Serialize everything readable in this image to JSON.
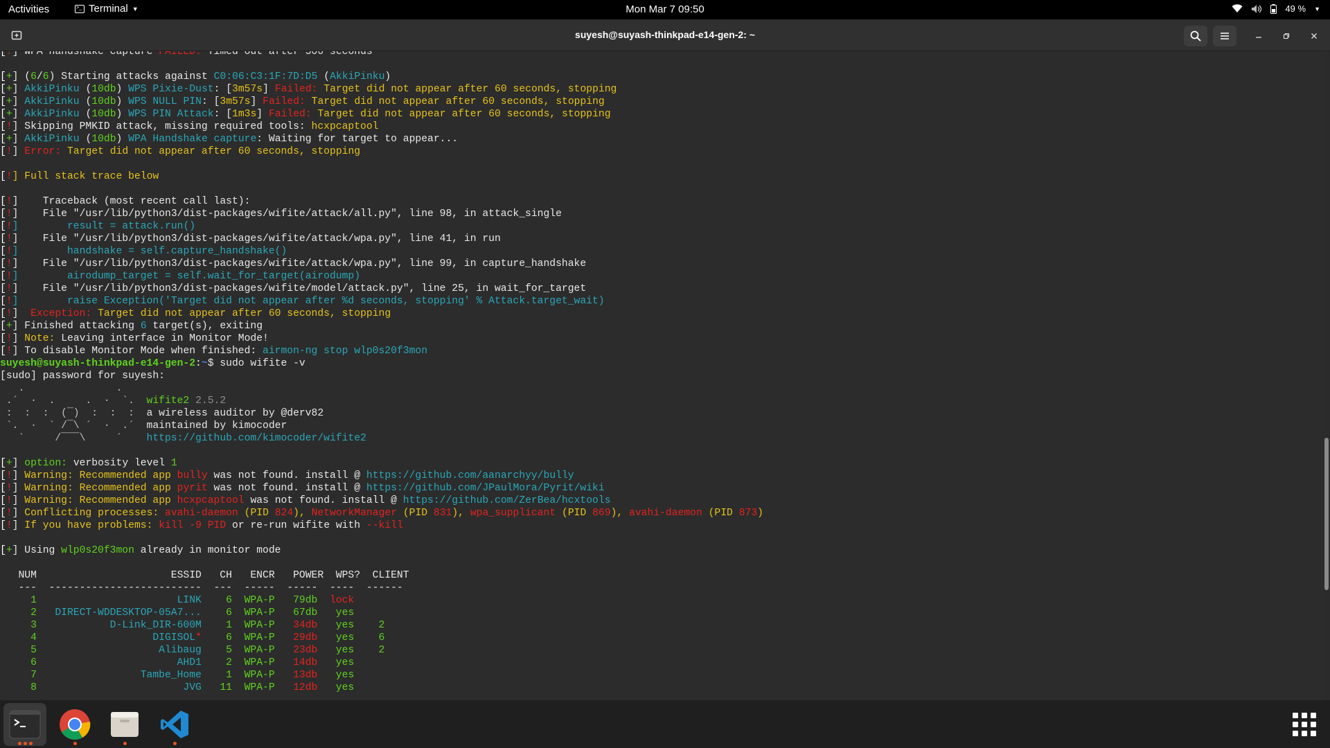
{
  "topbar": {
    "activities": "Activities",
    "app_name": "Terminal",
    "clock": "Mon Mar 7  09:50",
    "battery": "49 %"
  },
  "window": {
    "title": "suyesh@suyash-thinkpad-e14-gen-2: ~"
  },
  "icons": {
    "new_tab": "new-tab-icon",
    "search": "search-icon",
    "menu": "hamburger-menu-icon",
    "minimize": "minimize-icon",
    "maximize": "maximize-icon",
    "close": "close-icon",
    "wifi": "wifi-icon",
    "volume": "volume-icon",
    "battery": "battery-icon"
  },
  "colors": {
    "red": "#e3231f",
    "green": "#5fd21e",
    "cyan": "#2aa7b8",
    "yellow": "#e6c21b",
    "prompt_blue": "#4b7fd8",
    "accent": "#e95420"
  },
  "terminal": {
    "lines": [
      [
        {
          "t": "[",
          "c": "w"
        },
        {
          "t": "!",
          "c": "r"
        },
        {
          "t": "] WPA handshake capture "
        },
        {
          "t": "FAILED:",
          "c": "r"
        },
        {
          "t": " Timed out after 500 seconds"
        }
      ],
      [],
      [
        {
          "t": "[",
          "c": "w"
        },
        {
          "t": "+",
          "c": "g"
        },
        {
          "t": "] ("
        },
        {
          "t": "6",
          "c": "g"
        },
        {
          "t": "/"
        },
        {
          "t": "6",
          "c": "g"
        },
        {
          "t": ") Starting attacks against "
        },
        {
          "t": "C0:06:C3:1F:7D:D5",
          "c": "c"
        },
        {
          "t": " ("
        },
        {
          "t": "AkkiPinku",
          "c": "c"
        },
        {
          "t": ")"
        }
      ],
      [
        {
          "t": "[",
          "c": "w"
        },
        {
          "t": "+",
          "c": "g"
        },
        {
          "t": "] "
        },
        {
          "t": "AkkiPinku",
          "c": "c"
        },
        {
          "t": " ("
        },
        {
          "t": "10db",
          "c": "g"
        },
        {
          "t": ") "
        },
        {
          "t": "WPS Pixie-Dust",
          "c": "c"
        },
        {
          "t": ": ["
        },
        {
          "t": "3m57s",
          "c": "y"
        },
        {
          "t": "] "
        },
        {
          "t": "Failed:",
          "c": "r"
        },
        {
          "t": " Target did not appear after 60 seconds, stopping",
          "c": "y"
        }
      ],
      [
        {
          "t": "[",
          "c": "w"
        },
        {
          "t": "+",
          "c": "g"
        },
        {
          "t": "] "
        },
        {
          "t": "AkkiPinku",
          "c": "c"
        },
        {
          "t": " ("
        },
        {
          "t": "10db",
          "c": "g"
        },
        {
          "t": ") "
        },
        {
          "t": "WPS NULL PIN",
          "c": "c"
        },
        {
          "t": ": ["
        },
        {
          "t": "3m57s",
          "c": "y"
        },
        {
          "t": "] "
        },
        {
          "t": "Failed:",
          "c": "r"
        },
        {
          "t": " Target did not appear after 60 seconds, stopping",
          "c": "y"
        }
      ],
      [
        {
          "t": "[",
          "c": "w"
        },
        {
          "t": "+",
          "c": "g"
        },
        {
          "t": "] "
        },
        {
          "t": "AkkiPinku",
          "c": "c"
        },
        {
          "t": " ("
        },
        {
          "t": "10db",
          "c": "g"
        },
        {
          "t": ") "
        },
        {
          "t": "WPS PIN Attack",
          "c": "c"
        },
        {
          "t": ": ["
        },
        {
          "t": "1m3s",
          "c": "y"
        },
        {
          "t": "] "
        },
        {
          "t": "Failed:",
          "c": "r"
        },
        {
          "t": " Target did not appear after 60 seconds, stopping",
          "c": "y"
        }
      ],
      [
        {
          "t": "[",
          "c": "w"
        },
        {
          "t": "!",
          "c": "r"
        },
        {
          "t": "] Skipping PMKID attack, missing required tools: "
        },
        {
          "t": "hcxpcaptool",
          "c": "y"
        }
      ],
      [
        {
          "t": "[",
          "c": "w"
        },
        {
          "t": "+",
          "c": "g"
        },
        {
          "t": "] "
        },
        {
          "t": "AkkiPinku",
          "c": "c"
        },
        {
          "t": " ("
        },
        {
          "t": "10db",
          "c": "g"
        },
        {
          "t": ") "
        },
        {
          "t": "WPA Handshake capture",
          "c": "c"
        },
        {
          "t": ": Waiting for target to appear..."
        }
      ],
      [
        {
          "t": "[",
          "c": "w"
        },
        {
          "t": "!",
          "c": "r"
        },
        {
          "t": "] "
        },
        {
          "t": "Error:",
          "c": "r"
        },
        {
          "t": " Target did not appear after 60 seconds, stopping",
          "c": "y"
        }
      ],
      [],
      [
        {
          "t": "[",
          "c": "w"
        },
        {
          "t": "!",
          "c": "r"
        },
        {
          "t": "] Full stack trace below",
          "c": "y"
        }
      ],
      [],
      [
        {
          "t": "[",
          "c": "w"
        },
        {
          "t": "!",
          "c": "r"
        },
        {
          "t": "]    Traceback (most recent call last):"
        }
      ],
      [
        {
          "t": "[",
          "c": "w"
        },
        {
          "t": "!",
          "c": "r"
        },
        {
          "t": "]    File \"/usr/lib/python3/dist-packages/wifite/attack/all.py\", line 98, in attack_single"
        }
      ],
      [
        {
          "t": "[",
          "c": "w"
        },
        {
          "t": "!",
          "c": "r"
        },
        {
          "t": "]        result = attack.run()",
          "c": "c"
        }
      ],
      [
        {
          "t": "[",
          "c": "w"
        },
        {
          "t": "!",
          "c": "r"
        },
        {
          "t": "]    File \"/usr/lib/python3/dist-packages/wifite/attack/wpa.py\", line 41, in run"
        }
      ],
      [
        {
          "t": "[",
          "c": "w"
        },
        {
          "t": "!",
          "c": "r"
        },
        {
          "t": "]        handshake = self.capture_handshake()",
          "c": "c"
        }
      ],
      [
        {
          "t": "[",
          "c": "w"
        },
        {
          "t": "!",
          "c": "r"
        },
        {
          "t": "]    File \"/usr/lib/python3/dist-packages/wifite/attack/wpa.py\", line 99, in capture_handshake"
        }
      ],
      [
        {
          "t": "[",
          "c": "w"
        },
        {
          "t": "!",
          "c": "r"
        },
        {
          "t": "]        airodump_target = self.wait_for_target(airodump)",
          "c": "c"
        }
      ],
      [
        {
          "t": "[",
          "c": "w"
        },
        {
          "t": "!",
          "c": "r"
        },
        {
          "t": "]    File \"/usr/lib/python3/dist-packages/wifite/model/attack.py\", line 25, in wait_for_target"
        }
      ],
      [
        {
          "t": "[",
          "c": "w"
        },
        {
          "t": "!",
          "c": "r"
        },
        {
          "t": "]        raise Exception('Target did not appear after %d seconds, stopping' % Attack.target_wait)",
          "c": "c"
        }
      ],
      [
        {
          "t": "[",
          "c": "w"
        },
        {
          "t": "!",
          "c": "r"
        },
        {
          "t": "]  "
        },
        {
          "t": "Exception:",
          "c": "r"
        },
        {
          "t": " Target did not appear after 60 seconds, stopping",
          "c": "y"
        }
      ],
      [
        {
          "t": "[",
          "c": "w"
        },
        {
          "t": "+",
          "c": "g"
        },
        {
          "t": "] Finished attacking "
        },
        {
          "t": "6",
          "c": "c"
        },
        {
          "t": " target(s), exiting"
        }
      ],
      [
        {
          "t": "[",
          "c": "w"
        },
        {
          "t": "!",
          "c": "r"
        },
        {
          "t": "] "
        },
        {
          "t": "Note:",
          "c": "y"
        },
        {
          "t": " Leaving interface in Monitor Mode!"
        }
      ],
      [
        {
          "t": "[",
          "c": "w"
        },
        {
          "t": "!",
          "c": "r"
        },
        {
          "t": "] To disable Monitor Mode when finished: "
        },
        {
          "t": "airmon-ng stop wlp0s20f3mon",
          "c": "c"
        }
      ],
      [
        {
          "t": "suyesh@suyash-thinkpad-e14-gen-2",
          "c": "pr"
        },
        {
          "t": ":",
          "c": "w"
        },
        {
          "t": "~",
          "c": "pb"
        },
        {
          "t": "$ sudo wifite -v"
        }
      ],
      [
        {
          "t": "[sudo] password for suyesh:"
        }
      ],
      [
        {
          "t": "   .               .",
          "c": "gr"
        }
      ],
      [
        {
          "t": " .´  ·  .     .  ·  `.  ",
          "c": "gr"
        },
        {
          "t": "wifite2 ",
          "c": "g"
        },
        {
          "t": "2.5.2",
          "c": "dim"
        }
      ],
      [
        {
          "t": " :  :  :  (¯)  :  :  :  ",
          "c": "gr"
        },
        {
          "t": "a wireless auditor by @derv82"
        }
      ],
      [
        {
          "t": " `.  ·  ` /¯\\ ´  ·  .´  ",
          "c": "gr"
        },
        {
          "t": "maintained by kimocoder"
        }
      ],
      [
        {
          "t": "   `     /¯¯¯\\     ´    ",
          "c": "gr"
        },
        {
          "t": "https://github.com/kimocoder/wifite2",
          "c": "c"
        }
      ],
      [],
      [
        {
          "t": "[",
          "c": "w"
        },
        {
          "t": "+",
          "c": "g"
        },
        {
          "t": "] "
        },
        {
          "t": "option:",
          "c": "g"
        },
        {
          "t": " verbosity level "
        },
        {
          "t": "1",
          "c": "g"
        }
      ],
      [
        {
          "t": "[",
          "c": "w"
        },
        {
          "t": "!",
          "c": "r"
        },
        {
          "t": "] "
        },
        {
          "t": "Warning:",
          "c": "y"
        },
        {
          "t": " Recommended app ",
          "c": "y"
        },
        {
          "t": "bully",
          "c": "r"
        },
        {
          "t": " was not found. install @ "
        },
        {
          "t": "https://github.com/aanarchyy/bully",
          "c": "c"
        }
      ],
      [
        {
          "t": "[",
          "c": "w"
        },
        {
          "t": "!",
          "c": "r"
        },
        {
          "t": "] "
        },
        {
          "t": "Warning:",
          "c": "y"
        },
        {
          "t": " Recommended app ",
          "c": "y"
        },
        {
          "t": "pyrit",
          "c": "r"
        },
        {
          "t": " was not found. install @ "
        },
        {
          "t": "https://github.com/JPaulMora/Pyrit/wiki",
          "c": "c"
        }
      ],
      [
        {
          "t": "[",
          "c": "w"
        },
        {
          "t": "!",
          "c": "r"
        },
        {
          "t": "] "
        },
        {
          "t": "Warning:",
          "c": "y"
        },
        {
          "t": " Recommended app ",
          "c": "y"
        },
        {
          "t": "hcxpcaptool",
          "c": "r"
        },
        {
          "t": " was not found. install @ "
        },
        {
          "t": "https://github.com/ZerBea/hcxtools",
          "c": "c"
        }
      ],
      [
        {
          "t": "[",
          "c": "w"
        },
        {
          "t": "!",
          "c": "r"
        },
        {
          "t": "] "
        },
        {
          "t": "Conflicting processes: ",
          "c": "y"
        },
        {
          "t": "avahi-daemon",
          "c": "r"
        },
        {
          "t": " (PID ",
          "c": "y"
        },
        {
          "t": "824",
          "c": "r"
        },
        {
          "t": "), ",
          "c": "y"
        },
        {
          "t": "NetworkManager",
          "c": "r"
        },
        {
          "t": " (PID ",
          "c": "y"
        },
        {
          "t": "831",
          "c": "r"
        },
        {
          "t": "), ",
          "c": "y"
        },
        {
          "t": "wpa_supplicant",
          "c": "r"
        },
        {
          "t": " (PID ",
          "c": "y"
        },
        {
          "t": "869",
          "c": "r"
        },
        {
          "t": "), ",
          "c": "y"
        },
        {
          "t": "avahi-daemon",
          "c": "r"
        },
        {
          "t": " (PID ",
          "c": "y"
        },
        {
          "t": "873",
          "c": "r"
        },
        {
          "t": ")",
          "c": "y"
        }
      ],
      [
        {
          "t": "[",
          "c": "w"
        },
        {
          "t": "!",
          "c": "r"
        },
        {
          "t": "] "
        },
        {
          "t": "If you have problems: ",
          "c": "y"
        },
        {
          "t": "kill -9 PID",
          "c": "r"
        },
        {
          "t": " or re-run wifite with "
        },
        {
          "t": "--kill",
          "c": "r"
        }
      ],
      [],
      [
        {
          "t": "[",
          "c": "w"
        },
        {
          "t": "+",
          "c": "g"
        },
        {
          "t": "] Using "
        },
        {
          "t": "wlp0s20f3mon",
          "c": "g"
        },
        {
          "t": " already in monitor mode"
        }
      ],
      [],
      [
        {
          "t": "   NUM                      ESSID   CH   ENCR   POWER  WPS?  CLIENT"
        }
      ],
      [
        {
          "t": "   ---  -------------------------  ---  -----  -----  ----  ------"
        }
      ],
      [
        {
          "t": "     1",
          "c": "g"
        },
        {
          "t": "                       LINK",
          "c": "c"
        },
        {
          "t": "    6",
          "c": "g"
        },
        {
          "t": "  WPA-P",
          "c": "g"
        },
        {
          "t": "   79db",
          "c": "g"
        },
        {
          "t": "  lock",
          "c": "r"
        }
      ],
      [
        {
          "t": "     2",
          "c": "g"
        },
        {
          "t": "   DIRECT-WDDESKTOP-05A7...",
          "c": "c"
        },
        {
          "t": "    6",
          "c": "g"
        },
        {
          "t": "  WPA-P",
          "c": "g"
        },
        {
          "t": "   67db",
          "c": "g"
        },
        {
          "t": "   yes",
          "c": "g"
        }
      ],
      [
        {
          "t": "     3",
          "c": "g"
        },
        {
          "t": "            D-Link_DIR-600M",
          "c": "c"
        },
        {
          "t": "    1",
          "c": "g"
        },
        {
          "t": "  WPA-P",
          "c": "g"
        },
        {
          "t": "   34db",
          "c": "r"
        },
        {
          "t": "   yes",
          "c": "g"
        },
        {
          "t": "    2",
          "c": "g"
        }
      ],
      [
        {
          "t": "     4",
          "c": "g"
        },
        {
          "t": "                   DIGISOL",
          "c": "c"
        },
        {
          "t": "*",
          "c": "r"
        },
        {
          "t": "    6",
          "c": "g"
        },
        {
          "t": "  WPA-P",
          "c": "g"
        },
        {
          "t": "   29db",
          "c": "r"
        },
        {
          "t": "   yes",
          "c": "g"
        },
        {
          "t": "    6",
          "c": "g"
        }
      ],
      [
        {
          "t": "     5",
          "c": "g"
        },
        {
          "t": "                    Alibaug",
          "c": "c"
        },
        {
          "t": "    5",
          "c": "g"
        },
        {
          "t": "  WPA-P",
          "c": "g"
        },
        {
          "t": "   23db",
          "c": "r"
        },
        {
          "t": "   yes",
          "c": "g"
        },
        {
          "t": "    2",
          "c": "g"
        }
      ],
      [
        {
          "t": "     6",
          "c": "g"
        },
        {
          "t": "                       AHD1",
          "c": "c"
        },
        {
          "t": "    2",
          "c": "g"
        },
        {
          "t": "  WPA-P",
          "c": "g"
        },
        {
          "t": "   14db",
          "c": "r"
        },
        {
          "t": "   yes",
          "c": "g"
        }
      ],
      [
        {
          "t": "     7",
          "c": "g"
        },
        {
          "t": "                 Tambe_Home",
          "c": "c"
        },
        {
          "t": "    1",
          "c": "g"
        },
        {
          "t": "  WPA-P",
          "c": "g"
        },
        {
          "t": "   13db",
          "c": "r"
        },
        {
          "t": "   yes",
          "c": "g"
        }
      ],
      [
        {
          "t": "     8",
          "c": "g"
        },
        {
          "t": "                        JVG",
          "c": "c"
        },
        {
          "t": "   11",
          "c": "g"
        },
        {
          "t": "  WPA-P",
          "c": "g"
        },
        {
          "t": "   12db",
          "c": "r"
        },
        {
          "t": "   yes",
          "c": "g"
        }
      ]
    ]
  },
  "dock": {
    "apps": [
      {
        "name": "terminal",
        "icon": "terminal-icon",
        "running": 3
      },
      {
        "name": "chrome",
        "icon": "chrome-icon",
        "running": 1
      },
      {
        "name": "files",
        "icon": "files-icon",
        "running": 1
      },
      {
        "name": "vscode",
        "icon": "vscode-icon",
        "running": 1
      }
    ],
    "show_apps_icon": "show-apps-icon"
  }
}
